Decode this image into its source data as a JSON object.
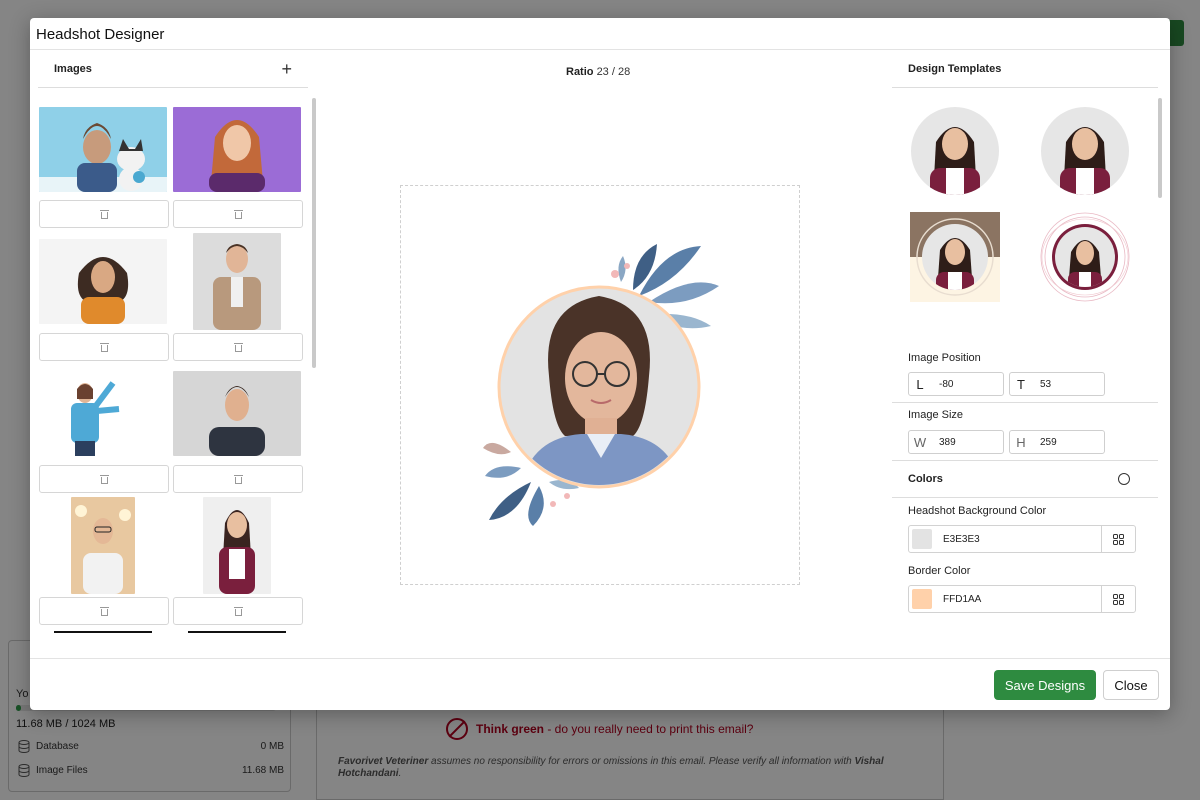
{
  "modal": {
    "title": "Headshot Designer"
  },
  "images_panel": {
    "title": "Images",
    "add_icon": "plus-icon",
    "items": [
      {
        "name": "woman-with-husky",
        "bg": "#8fd0e8"
      },
      {
        "name": "redhead-woman-purple",
        "bg": "#9b6cd6"
      },
      {
        "name": "curly-woman-orange",
        "bg": "#f4f4f4"
      },
      {
        "name": "man-beige-blazer",
        "bg": "#dcdcdc"
      },
      {
        "name": "woman-blue-sweater",
        "bg": "#ffffff"
      },
      {
        "name": "man-dark-sweater",
        "bg": "#d6d6d6"
      },
      {
        "name": "man-glasses-headphones",
        "bg": "#e8c8a0"
      },
      {
        "name": "woman-burgundy-cardigan",
        "bg": "#efefef"
      }
    ],
    "delete_icon": "trash-icon"
  },
  "canvas": {
    "ratio_label": "Ratio",
    "ratio_value": "23 / 28",
    "background_color": "#E3E3E3",
    "border_color": "#FFD1AA"
  },
  "templates_panel": {
    "title": "Design Templates",
    "templates": [
      {
        "name": "circle-plain"
      },
      {
        "name": "circle-plain-2"
      },
      {
        "name": "square-split-frame"
      },
      {
        "name": "circle-ornate-ring"
      }
    ],
    "image_position": {
      "title": "Image Position",
      "left_key": "L",
      "left_value": "-80",
      "top_key": "T",
      "top_value": "53"
    },
    "image_size": {
      "title": "Image Size",
      "width_key": "W",
      "width_value": "389",
      "height_key": "H",
      "height_value": "259"
    },
    "colors": {
      "title": "Colors",
      "reset_icon": "history-icon",
      "background": {
        "label": "Headshot Background Color",
        "value": "E3E3E3",
        "swatch": "#E3E3E3"
      },
      "border": {
        "label": "Border Color",
        "value": "FFD1AA",
        "swatch": "#FFD1AA"
      },
      "picker_icon": "color-picker-icon"
    }
  },
  "footer": {
    "save_label": "Save Designs",
    "close_label": "Close"
  },
  "background_page": {
    "storage_label": "Yo",
    "storage_fraction": 0.0114,
    "storage_total": "11.68 MB / 1024 MB",
    "database_label": "Database",
    "database_value": "0 MB",
    "image_files_label": "Image Files",
    "image_files_value": "11.68 MB",
    "think_green_bold": "Think green",
    "think_green_rest": " - do you really need to print this email?",
    "disclaimer_brand": "Favorivet Veteriner",
    "disclaimer_text": " assumes no responsibility for errors or omissions in this email. Please verify all information with ",
    "disclaimer_name": "Vishal Hotchandani",
    "disclaimer_end": "."
  }
}
